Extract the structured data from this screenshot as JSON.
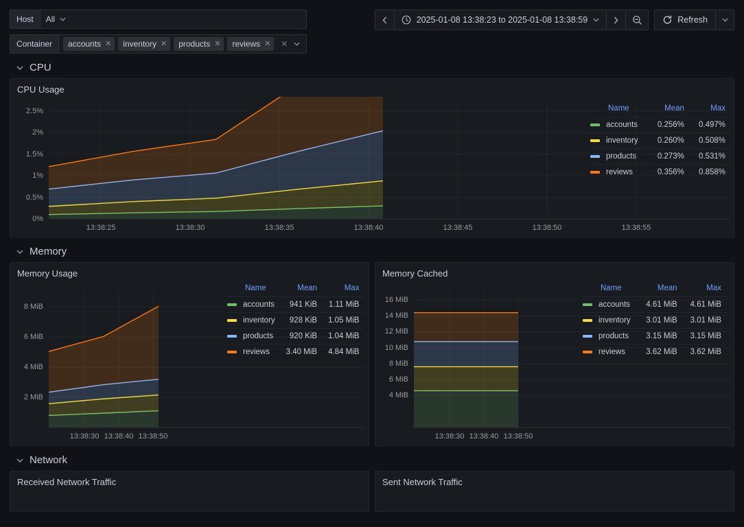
{
  "variables": {
    "host": {
      "label": "Host",
      "value": "All"
    },
    "container": {
      "label": "Container",
      "chips": [
        "accounts",
        "inventory",
        "products",
        "reviews"
      ],
      "clear_icon": "close-icon",
      "dropdown_icon": "chevron-down-icon"
    }
  },
  "timepicker": {
    "prev_icon": "chevron-left-icon",
    "clock_icon": "clock-icon",
    "range": "2025-01-08 13:38:23 to 2025-01-08 13:38:59",
    "dropdown_icon": "chevron-down-icon",
    "next_icon": "chevron-right-icon",
    "zoom_out_icon": "zoom-out-icon",
    "refresh_label": "Refresh",
    "refresh_icon": "refresh-icon",
    "refresh_dropdown_icon": "chevron-down-icon"
  },
  "sections": [
    {
      "id": "cpu",
      "title": "CPU"
    },
    {
      "id": "memory",
      "title": "Memory"
    },
    {
      "id": "network",
      "title": "Network"
    }
  ],
  "panels": {
    "cpu_usage": {
      "title": "CPU Usage"
    },
    "memory_usage": {
      "title": "Memory Usage"
    },
    "memory_cached": {
      "title": "Memory Cached"
    },
    "received_network_traffic": {
      "title": "Received Network Traffic"
    },
    "sent_network_traffic": {
      "title": "Sent Network Traffic"
    }
  },
  "legend_headers": {
    "name": "Name",
    "mean": "Mean",
    "max": "Max"
  },
  "colors": {
    "accounts": "#73bf69",
    "inventory": "#fade2a",
    "products": "#8ab8ff",
    "reviews": "#ff780a",
    "panel_bg": "#181b1f",
    "page_bg": "#111217",
    "grid": "#23262b",
    "text": "#ccccdc",
    "header_blue": "#6e9fff"
  },
  "chart_data": [
    {
      "id": "cpu_usage",
      "type": "area",
      "title": "CPU Usage",
      "stacked": true,
      "xlabel": "",
      "ylabel": "",
      "ylim": [
        0,
        2.7
      ],
      "yticks": [
        "0%",
        "0.5%",
        "1%",
        "1.5%",
        "2%",
        "2.5%"
      ],
      "ytick_values": [
        0,
        0.5,
        1,
        1.5,
        2,
        2.5
      ],
      "xticks": [
        "13:38:25",
        "13:38:30",
        "13:38:35",
        "13:38:40",
        "13:38:45",
        "13:38:50",
        "13:38:55"
      ],
      "x": [
        "13:38:23",
        "13:38:30",
        "13:38:35",
        "13:38:40",
        "13:38:45"
      ],
      "grid": true,
      "legend_position": "right",
      "series": [
        {
          "name": "accounts",
          "color": "#73bf69",
          "mean": "0.256%",
          "max": "0.497%",
          "values": [
            0.1,
            0.14,
            0.17,
            0.24,
            0.3
          ]
        },
        {
          "name": "inventory",
          "color": "#fade2a",
          "mean": "0.260%",
          "max": "0.508%",
          "values": [
            0.19,
            0.26,
            0.31,
            0.45,
            0.58
          ]
        },
        {
          "name": "products",
          "color": "#8ab8ff",
          "mean": "0.273%",
          "max": "0.531%",
          "values": [
            0.4,
            0.5,
            0.58,
            0.88,
            1.16
          ]
        },
        {
          "name": "reviews",
          "color": "#ff780a",
          "mean": "0.356%",
          "max": "0.858%",
          "values": [
            0.52,
            0.66,
            0.78,
            1.55,
            2.26
          ]
        }
      ]
    },
    {
      "id": "memory_usage",
      "type": "area",
      "title": "Memory Usage",
      "stacked": true,
      "xlabel": "",
      "ylabel": "",
      "ylim": [
        0,
        9.1
      ],
      "yticks": [
        "2 MiB",
        "4 MiB",
        "6 MiB",
        "8 MiB"
      ],
      "ytick_values": [
        2,
        4,
        6,
        8
      ],
      "xticks": [
        "13:38:30",
        "13:38:40",
        "13:38:50"
      ],
      "x": [
        "13:38:23",
        "13:38:32",
        "13:38:45"
      ],
      "grid": true,
      "legend_position": "right",
      "series": [
        {
          "name": "accounts",
          "color": "#73bf69",
          "mean": "941 KiB",
          "max": "1.11 MiB",
          "values": [
            0.8,
            0.95,
            1.11
          ]
        },
        {
          "name": "inventory",
          "color": "#fade2a",
          "mean": "928 KiB",
          "max": "1.05 MiB",
          "values": [
            0.78,
            0.95,
            1.05
          ]
        },
        {
          "name": "products",
          "color": "#8ab8ff",
          "mean": "920 KiB",
          "max": "1.04 MiB",
          "values": [
            0.76,
            0.94,
            1.04
          ]
        },
        {
          "name": "reviews",
          "color": "#ff780a",
          "mean": "3.40 MiB",
          "max": "4.84 MiB",
          "values": [
            2.7,
            3.2,
            4.84
          ]
        }
      ]
    },
    {
      "id": "memory_cached",
      "type": "area",
      "title": "Memory Cached",
      "stacked": true,
      "xlabel": "",
      "ylabel": "",
      "ylim": [
        0,
        17.2
      ],
      "yticks": [
        "4 MiB",
        "6 MiB",
        "8 MiB",
        "10 MiB",
        "12 MiB",
        "14 MiB",
        "16 MiB"
      ],
      "ytick_values": [
        4,
        6,
        8,
        10,
        12,
        14,
        16
      ],
      "xticks": [
        "13:38:30",
        "13:38:40",
        "13:38:50"
      ],
      "x": [
        "13:38:23",
        "13:38:32",
        "13:38:45"
      ],
      "grid": true,
      "legend_position": "right",
      "series": [
        {
          "name": "accounts",
          "color": "#73bf69",
          "mean": "4.61 MiB",
          "max": "4.61 MiB",
          "values": [
            4.61,
            4.61,
            4.61
          ]
        },
        {
          "name": "inventory",
          "color": "#fade2a",
          "mean": "3.01 MiB",
          "max": "3.01 MiB",
          "values": [
            3.01,
            3.01,
            3.01
          ]
        },
        {
          "name": "products",
          "color": "#8ab8ff",
          "mean": "3.15 MiB",
          "max": "3.15 MiB",
          "values": [
            3.15,
            3.15,
            3.15
          ]
        },
        {
          "name": "reviews",
          "color": "#ff780a",
          "mean": "3.62 MiB",
          "max": "3.62 MiB",
          "values": [
            3.62,
            3.62,
            3.62
          ]
        }
      ]
    }
  ]
}
